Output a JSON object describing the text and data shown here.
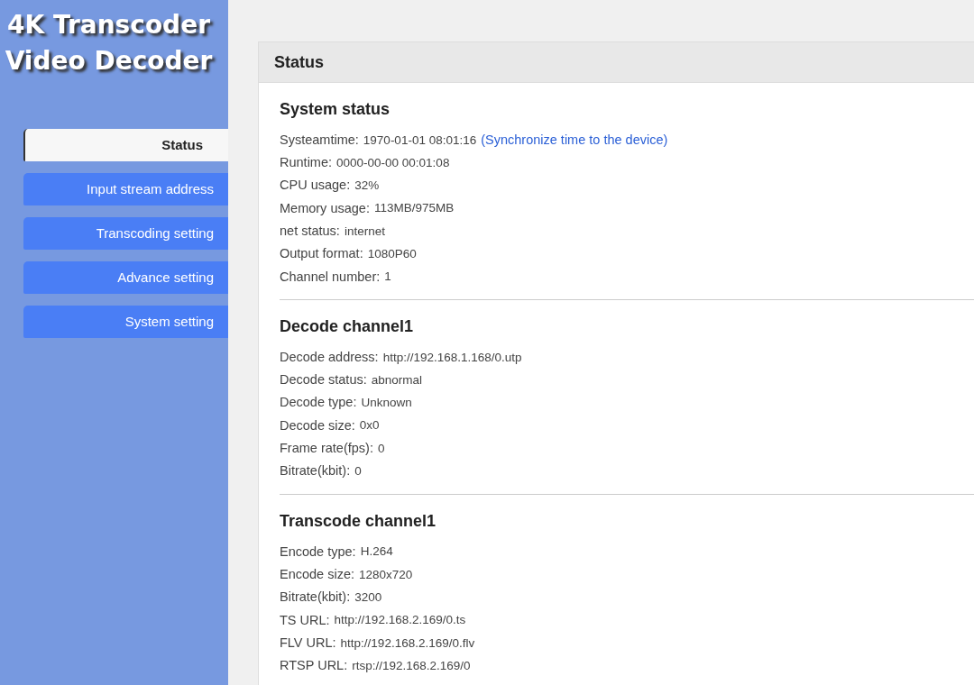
{
  "logo": {
    "lines": [
      "4K Transcoder",
      "Video Decoder"
    ]
  },
  "sidebar": {
    "items": [
      {
        "label": "Status",
        "selected": true
      },
      {
        "label": "Input stream address",
        "selected": false
      },
      {
        "label": "Transcoding setting",
        "selected": false
      },
      {
        "label": "Advance setting",
        "selected": false
      },
      {
        "label": "System setting",
        "selected": false
      }
    ]
  },
  "panel": {
    "title": "Status",
    "sections": [
      {
        "heading": "System status",
        "rows": [
          {
            "label": "Systeamtime:",
            "value": "1970-01-01 08:01:16",
            "link": "(Synchronize time to the device)"
          },
          {
            "label": "Runtime:",
            "value": "0000-00-00 00:01:08"
          },
          {
            "label": "CPU usage:",
            "value": "32%"
          },
          {
            "label": "Memory usage:",
            "value": "113MB/975MB"
          },
          {
            "label": "net status:",
            "value": "internet"
          },
          {
            "label": "Output format:",
            "value": "1080P60"
          },
          {
            "label": "Channel number:",
            "value": "1"
          }
        ]
      },
      {
        "heading": "Decode channel1",
        "rows": [
          {
            "label": "Decode address:",
            "value": "http://192.168.1.168/0.utp"
          },
          {
            "label": "Decode status:",
            "value": "abnormal"
          },
          {
            "label": "Decode type:",
            "value": "Unknown"
          },
          {
            "label": "Decode size:",
            "value": "0x0"
          },
          {
            "label": "Frame rate(fps):",
            "value": "0"
          },
          {
            "label": "Bitrate(kbit):",
            "value": "0"
          }
        ]
      },
      {
        "heading": "Transcode channel1",
        "rows": [
          {
            "label": "Encode type:",
            "value": "H.264"
          },
          {
            "label": "Encode size:",
            "value": "1280x720"
          },
          {
            "label": "Bitrate(kbit):",
            "value": "3200"
          },
          {
            "label": "TS URL:",
            "value": "http://192.168.2.169/0.ts"
          },
          {
            "label": "FLV URL:",
            "value": "http://192.168.2.169/0.flv"
          },
          {
            "label": "RTSP URL:",
            "value": "rtsp://192.168.2.169/0"
          }
        ]
      }
    ]
  }
}
